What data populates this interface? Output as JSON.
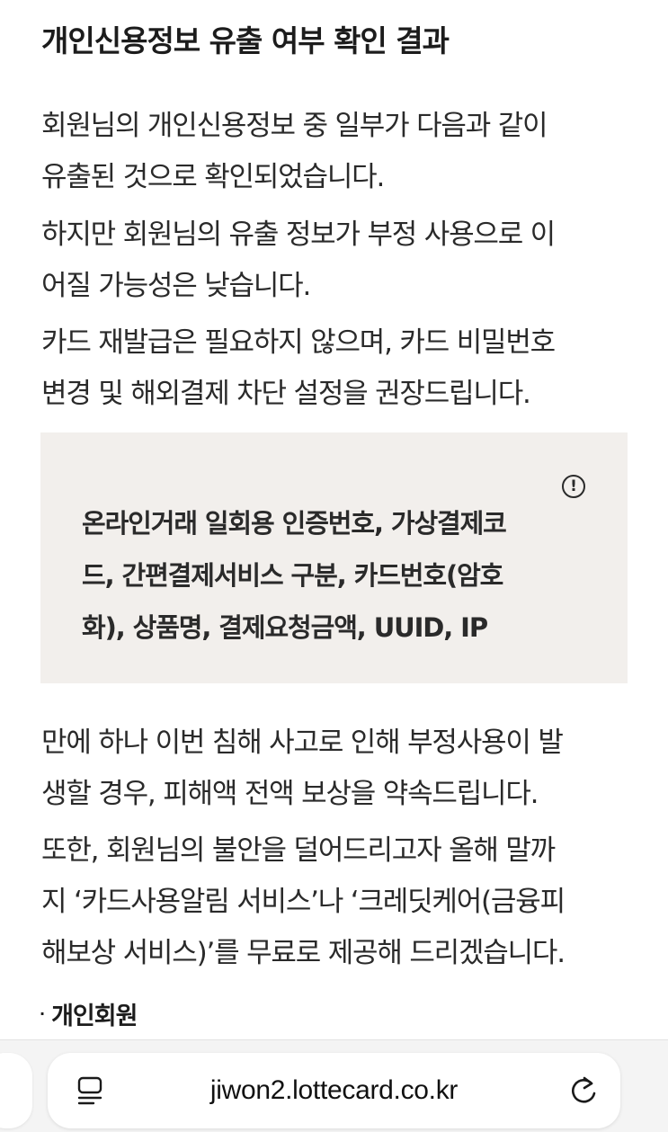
{
  "title": "개인신용정보 유출 여부 확인 결과",
  "paragraphs": {
    "p1": [
      "회원님의 개인신용정보 중 일부가 다음과 같이",
      "유출된 것으로 확인되었습니다."
    ],
    "p2": [
      "하지만 회원님의 유출 정보가 부정 사용으로 이",
      "어질 가능성은 낮습니다."
    ],
    "p3": [
      "카드 재발급은 필요하지 않으며, 카드 비밀번호",
      "변경 및 해외결제 차단 설정을 권장드립니다."
    ],
    "p4": [
      "만에 하나 이번 침해 사고로 인해 부정사용이 발",
      "생할 경우, 피해액 전액 보상을 약속드립니다."
    ],
    "p5": [
      "또한, 회원님의 불안을 덜어드리고자 올해 말까",
      "지 ‘카드사용알림 서비스’나 ‘크레딧케어(금융피",
      "해보상 서비스)’를 무료로 제공해 드리겠습니다."
    ]
  },
  "info_box": {
    "icon": "info-circle-icon",
    "icon_glyph": "!",
    "lines": [
      "온라인거래 일회용 인증번호, 가상결제코",
      "드, 간편결제서비스 구분, 카드번호(암호",
      "화), 상품명, 결제요청금액, UUID, IP"
    ],
    "background": "#f2efec"
  },
  "section": {
    "bullet": "·",
    "label": "개인회원"
  },
  "browser": {
    "url": "jiwon2.lottecard.co.kr",
    "tabs_icon": "tabs-icon",
    "reload_icon": "reload-icon"
  }
}
